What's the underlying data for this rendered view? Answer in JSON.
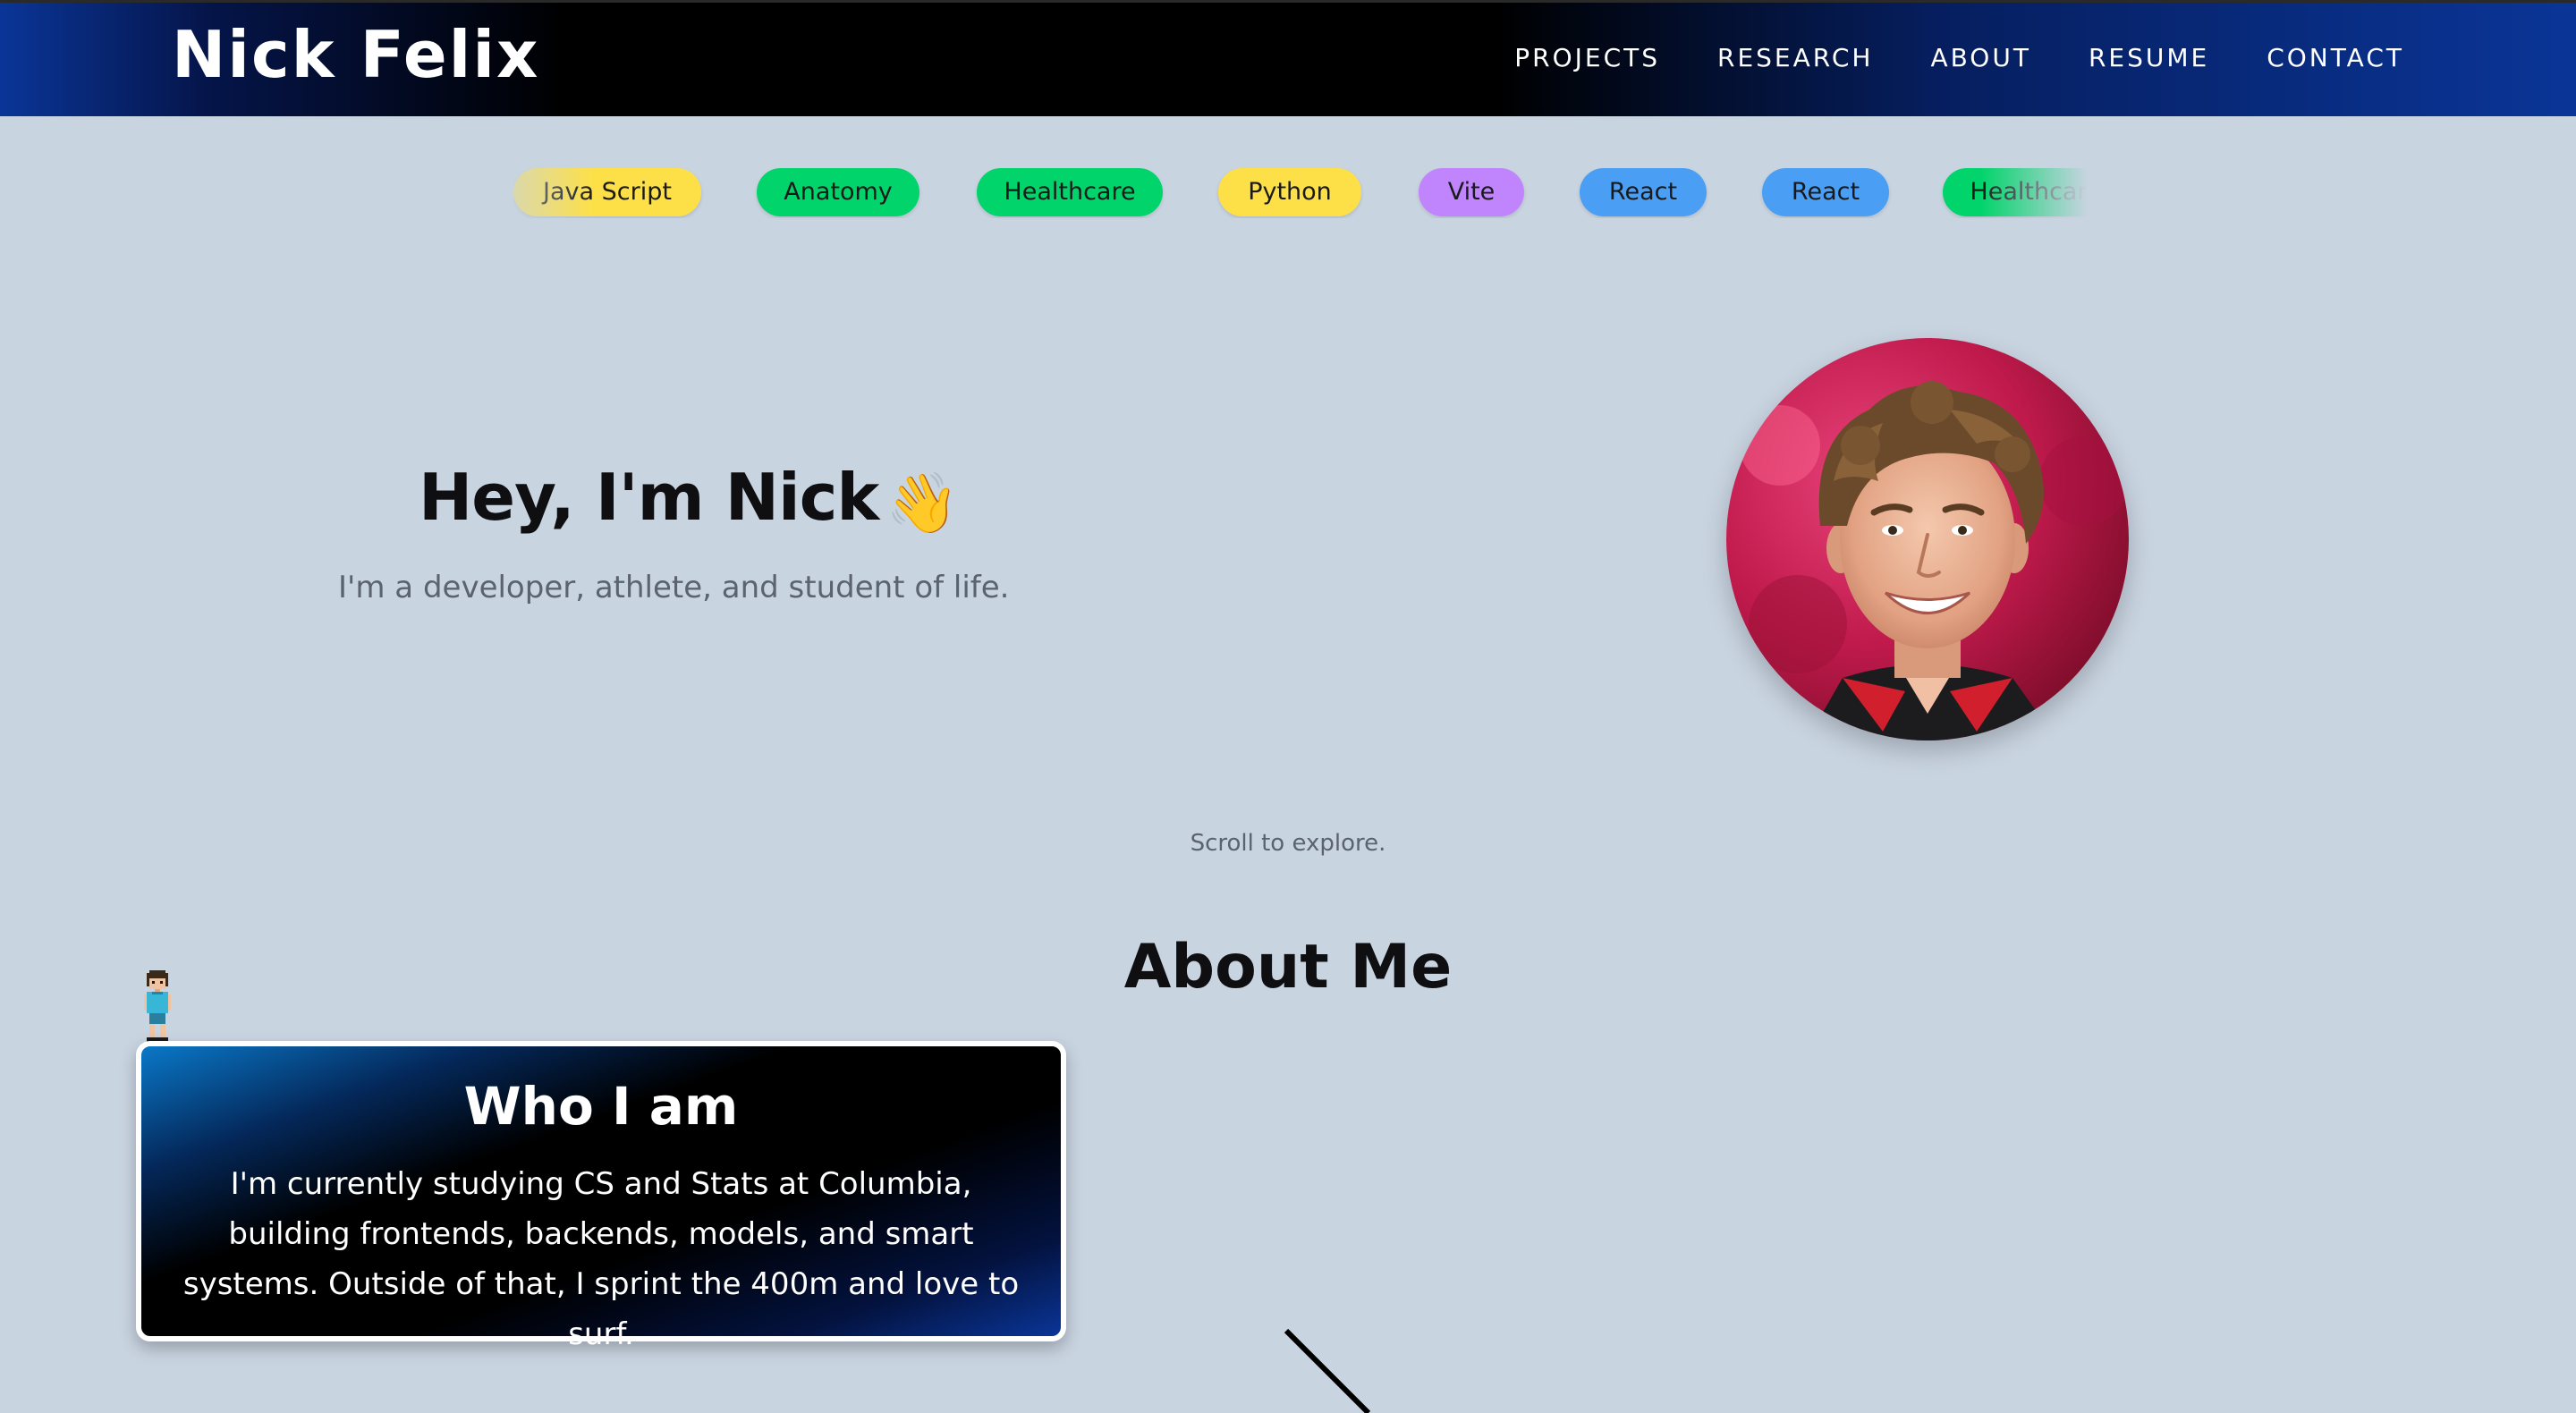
{
  "header": {
    "brand": "Nick Felix",
    "nav": [
      "PROJECTS",
      "RESEARCH",
      "ABOUT",
      "RESUME",
      "CONTACT"
    ]
  },
  "tags": [
    {
      "label": "Java Script",
      "color": "#fde047"
    },
    {
      "label": "Anatomy",
      "color": "#00d46a"
    },
    {
      "label": "Healthcare",
      "color": "#00d46a"
    },
    {
      "label": "Python",
      "color": "#fde047"
    },
    {
      "label": "Vite",
      "color": "#c084fc"
    },
    {
      "label": "React",
      "color": "#4a9ff5"
    },
    {
      "label": "React",
      "color": "#4a9ff5"
    },
    {
      "label": "Healthcare",
      "color": "#00d46a"
    }
  ],
  "hero": {
    "title": "Hey, I'm Nick",
    "title_icon": "waving-hand-icon",
    "subtitle": "I'm a developer, athlete, and student of life.",
    "avatar": "profile-photo"
  },
  "scroll_hint": "Scroll to explore.",
  "about": {
    "heading": "About Me",
    "card": {
      "title": "Who I am",
      "body": "I'm currently studying CS and Stats at Columbia, building frontends, backends, models, and smart systems. Outside of that, I sprint the 400m and love to surf."
    },
    "sprite": "pixel-runner-sprite"
  },
  "colors": {
    "page_background": "#c9d4e1",
    "header_blue": "#0a3597",
    "text_dark": "#0f0f12",
    "text_muted": "#5b6270"
  }
}
